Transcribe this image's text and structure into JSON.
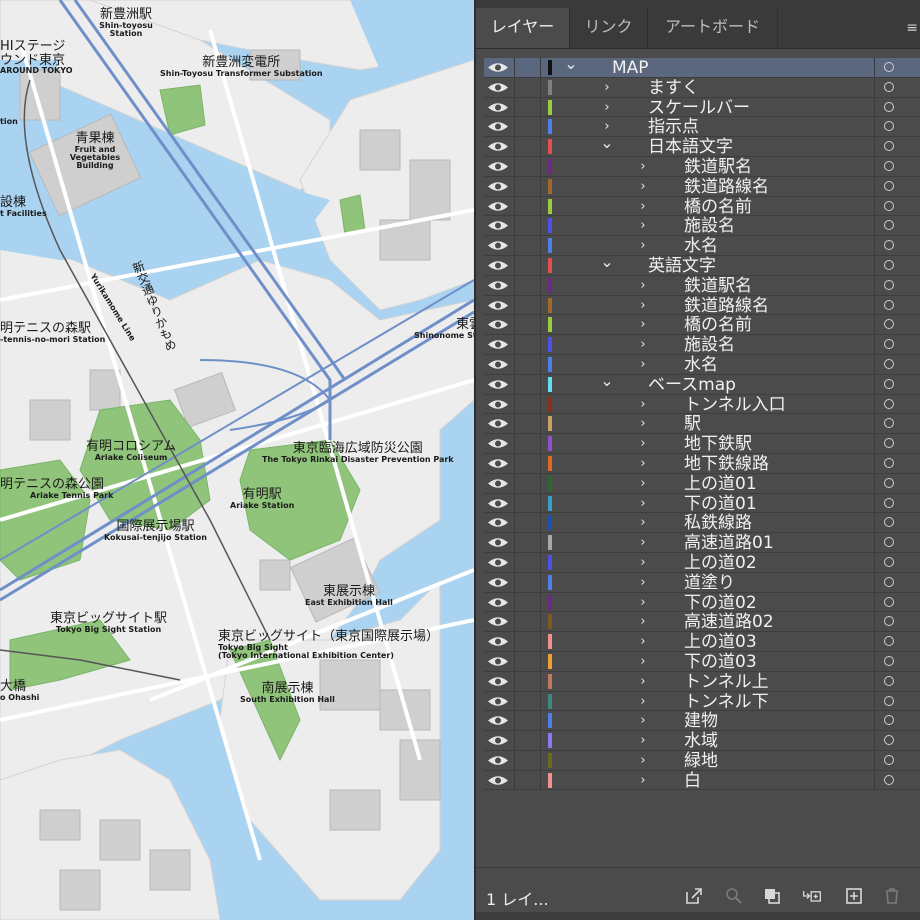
{
  "map": {
    "labels": [
      {
        "ja": "新豊洲駅",
        "en": "Shin-toyosu Station"
      },
      {
        "ja": "新豊洲変電所",
        "en": "Shin-Toyosu Transformer Substation"
      },
      {
        "ja": "HIステージ",
        "en": ""
      },
      {
        "ja": "ウンド東京",
        "en": "AROUND TOKYO"
      },
      {
        "ja": "tion",
        "en": ""
      },
      {
        "ja": "青果棟",
        "en": "Fruit and Vegetables Building"
      },
      {
        "ja": "t Facilities",
        "en": ""
      },
      {
        "ja": "明テニスの森駅",
        "en": "-tennis-no-mori Station"
      },
      {
        "ja": "有明コロシアム",
        "en": "Ariake Coliseum"
      },
      {
        "ja": "東京臨海広域防災公園",
        "en": "The Tokyo Rinkai Disaster Prevention Park"
      },
      {
        "ja": "明テニスの森公園",
        "en": "Ariake Tennis Park"
      },
      {
        "ja": "有明駅",
        "en": "Ariake Station"
      },
      {
        "ja": "国際展示場駅",
        "en": "Kokusai-tenjijo Station"
      },
      {
        "ja": "東展示棟",
        "en": "East Exhibition Hall"
      },
      {
        "ja": "東京ビッグサイト駅",
        "en": "Tokyo Big Sight Station"
      },
      {
        "ja": "東京ビッグサイト（東京国際展示場）",
        "en": "Tokyo Big Sight",
        "en2": "(Tokyo International Exhibition Center)"
      },
      {
        "ja": "南展示棟",
        "en": "South Exhibition Hall"
      },
      {
        "ja": "東雲",
        "en": "Shinonome Sta"
      },
      {
        "ja": "大橋",
        "en": "o Ohashi"
      },
      {
        "ja": "設棟",
        "en": ""
      }
    ],
    "line_label": {
      "ja": "新交通ゆりかもめ",
      "en": "Yurikamome Line"
    }
  },
  "panel": {
    "tabs": [
      {
        "label": "レイヤー",
        "active": true
      },
      {
        "label": "リンク",
        "active": false
      },
      {
        "label": "アートボード",
        "active": false
      }
    ],
    "layers": [
      {
        "name": "MAP",
        "depth": 0,
        "expanded": true,
        "color": "#111111",
        "selected": true
      },
      {
        "name": "ますく",
        "depth": 1,
        "expanded": false,
        "color": "#7f7f7f"
      },
      {
        "name": "スケールバー",
        "depth": 1,
        "expanded": false,
        "color": "#9ccc3c"
      },
      {
        "name": "指示点",
        "depth": 1,
        "expanded": false,
        "color": "#4f7fe8"
      },
      {
        "name": "日本語文字",
        "depth": 1,
        "expanded": true,
        "color": "#e05050"
      },
      {
        "name": "鉄道駅名",
        "depth": 2,
        "expanded": false,
        "color": "#6e2a80"
      },
      {
        "name": "鉄道路線名",
        "depth": 2,
        "expanded": false,
        "color": "#a0682a"
      },
      {
        "name": "橋の名前",
        "depth": 2,
        "expanded": false,
        "color": "#9ccc3c"
      },
      {
        "name": "施設名",
        "depth": 2,
        "expanded": false,
        "color": "#5050e8"
      },
      {
        "name": "水名",
        "depth": 2,
        "expanded": false,
        "color": "#4f7fe8"
      },
      {
        "name": "英語文字",
        "depth": 1,
        "expanded": true,
        "color": "#e05050"
      },
      {
        "name": "鉄道駅名",
        "depth": 2,
        "expanded": false,
        "color": "#6e2a80"
      },
      {
        "name": "鉄道路線名",
        "depth": 2,
        "expanded": false,
        "color": "#a0682a"
      },
      {
        "name": "橋の名前",
        "depth": 2,
        "expanded": false,
        "color": "#9ccc3c"
      },
      {
        "name": "施設名",
        "depth": 2,
        "expanded": false,
        "color": "#5050e8"
      },
      {
        "name": "水名",
        "depth": 2,
        "expanded": false,
        "color": "#4f7fe8"
      },
      {
        "name": "ベースmap",
        "depth": 1,
        "expanded": true,
        "color": "#60e0f0"
      },
      {
        "name": "トンネル入口",
        "depth": 2,
        "expanded": false,
        "color": "#8a3018"
      },
      {
        "name": "駅",
        "depth": 2,
        "expanded": false,
        "color": "#c8a060"
      },
      {
        "name": "地下鉄駅",
        "depth": 2,
        "expanded": false,
        "color": "#9050d0"
      },
      {
        "name": "地下鉄線路",
        "depth": 2,
        "expanded": false,
        "color": "#e06820"
      },
      {
        "name": "上の道01",
        "depth": 2,
        "expanded": false,
        "color": "#2a6a30"
      },
      {
        "name": "下の道01",
        "depth": 2,
        "expanded": false,
        "color": "#3aa0c8"
      },
      {
        "name": "私鉄線路",
        "depth": 2,
        "expanded": false,
        "color": "#2050b0"
      },
      {
        "name": "高速道路01",
        "depth": 2,
        "expanded": false,
        "color": "#a8a8a8"
      },
      {
        "name": "上の道02",
        "depth": 2,
        "expanded": false,
        "color": "#5050e8"
      },
      {
        "name": "道塗り",
        "depth": 2,
        "expanded": false,
        "color": "#4f7fe8"
      },
      {
        "name": "下の道02",
        "depth": 2,
        "expanded": false,
        "color": "#6e2a80"
      },
      {
        "name": "高速道路02",
        "depth": 2,
        "expanded": false,
        "color": "#7a5a20"
      },
      {
        "name": "上の道03",
        "depth": 2,
        "expanded": false,
        "color": "#f09090"
      },
      {
        "name": "下の道03",
        "depth": 2,
        "expanded": false,
        "color": "#f0a030"
      },
      {
        "name": "トンネル上",
        "depth": 2,
        "expanded": false,
        "color": "#c07860"
      },
      {
        "name": "トンネル下",
        "depth": 2,
        "expanded": false,
        "color": "#3a8a80"
      },
      {
        "name": "建物",
        "depth": 2,
        "expanded": false,
        "color": "#4f7fe8"
      },
      {
        "name": "水域",
        "depth": 2,
        "expanded": false,
        "color": "#8a7af0"
      },
      {
        "name": "緑地",
        "depth": 2,
        "expanded": false,
        "color": "#6a6a20"
      },
      {
        "name": "白",
        "depth": 2,
        "expanded": false,
        "color": "#f09090"
      }
    ],
    "footer": {
      "layer_count": "1 レイ...",
      "icons": [
        "export-icon",
        "search-icon",
        "clipping-mask-icon",
        "new-sublayer-icon",
        "new-layer-icon",
        "trash-icon"
      ]
    }
  }
}
